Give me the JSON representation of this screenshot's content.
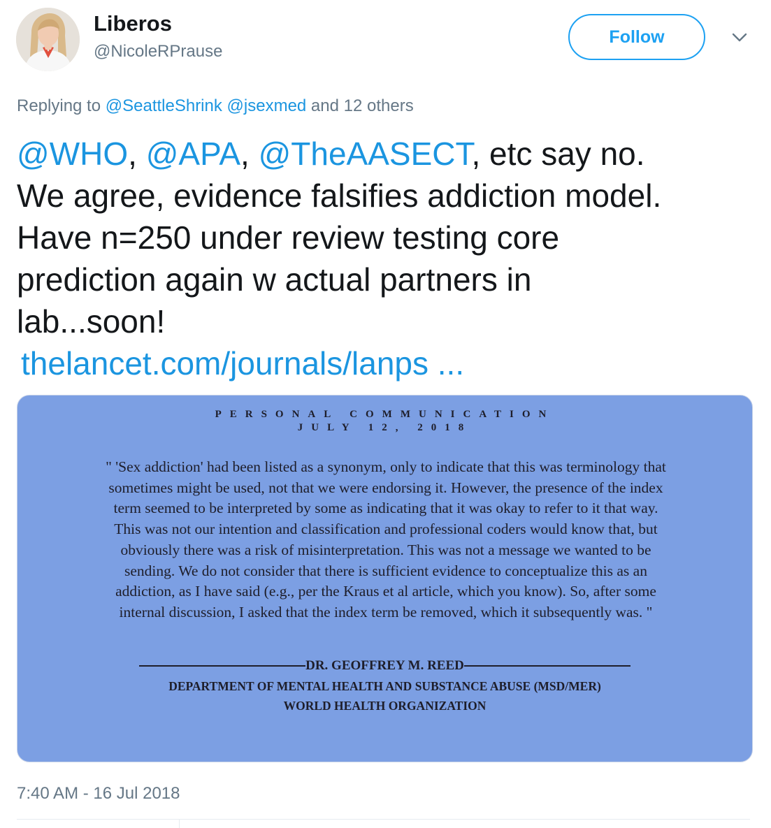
{
  "author": {
    "name": "Liberos",
    "handle": "@NicoleRPrause"
  },
  "follow_label": "Follow",
  "icons": {
    "menu": "chevron-down-icon",
    "avatar": "avatar-photo"
  },
  "reply": {
    "prefix": "Replying to ",
    "mention1": "@SeattleShrink",
    "mention2": "@jsexmed",
    "suffix": " and 12 others"
  },
  "tweet": {
    "m_who": "@WHO",
    "sep1": ", ",
    "m_apa": "@APA",
    "sep2": ", ",
    "m_aasect": "@TheAASECT",
    "line1_rest": ", etc say no.",
    "line2": "We agree, evidence falsifies addiction model.",
    "line3": "Have n=250 under review testing core",
    "line4": "prediction again w actual partners in",
    "line5": "lab...soon!",
    "link": "thelancet.com/journals/lanps  ..."
  },
  "media": {
    "header1": "PERSONAL COMMUNICATION",
    "header2": "JULY 12, 2018",
    "quote_lines": [
      "\" 'Sex addiction' had been listed as a synonym, only to indicate that this was terminology that",
      "sometimes might be used, not that we were endorsing it.  However, the presence of the index",
      "term seemed to be interpreted by some as indicating that it was okay to refer to it that way.",
      "This was not our intention and classification and professional coders would know that, but",
      "obviously there was a risk of misinterpretation.  This was not a message we wanted to be",
      "sending.  We do not consider that there is sufficient evidence to conceptualize this as an",
      "addiction, as I have said (e.g., per the Kraus et al article, which you know).  So, after some",
      "internal discussion, I asked that the index term be removed, which it subsequently was. \""
    ],
    "signature": "DR. GEOFFREY M. REED",
    "department": "DEPARTMENT OF MENTAL HEALTH AND SUBSTANCE ABUSE (MSD/MER)",
    "organization": "WORLD HEALTH ORGANIZATION",
    "background_color": "#7c9fe3"
  },
  "timestamp": "7:40 AM - 16 Jul 2018",
  "colors": {
    "accent": "#1da1f2",
    "link": "#1b95e0",
    "muted": "#657786",
    "text": "#14171a"
  }
}
